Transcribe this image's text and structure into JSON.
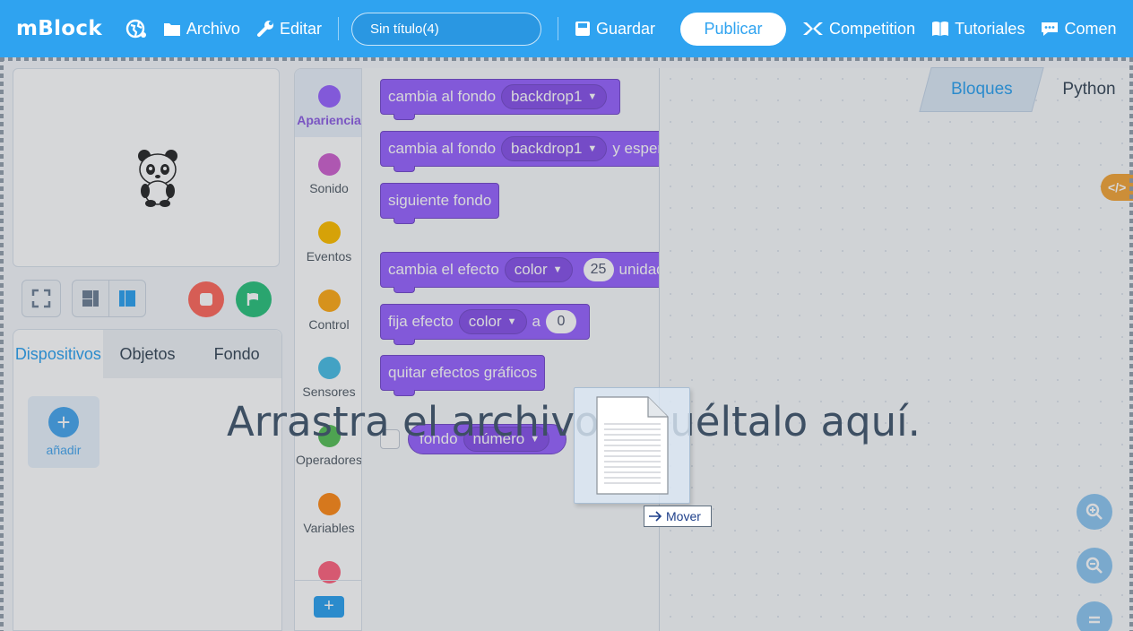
{
  "app": {
    "logo": "mBlock",
    "menu": {
      "file_label": "Archivo",
      "edit_label": "Editar",
      "save_label": "Guardar",
      "publish_label": "Publicar",
      "competition_label": "Competition",
      "tutorials_label": "Tutoriales",
      "comments_label": "Comen"
    },
    "project_title": "Sin título(4)",
    "accent_color": "#2fa3f0"
  },
  "left_panel": {
    "tabs": [
      "Dispositivos",
      "Objetos",
      "Fondo"
    ],
    "active_tab": "Dispositivos",
    "add_label": "añadir"
  },
  "categories": [
    {
      "label": "Apariencia",
      "color": "#9966ff",
      "active": true
    },
    {
      "label": "Sonido",
      "color": "#cf63cf"
    },
    {
      "label": "Eventos",
      "color": "#ffbf00"
    },
    {
      "label": "Control",
      "color": "#ffab19"
    },
    {
      "label": "Sensores",
      "color": "#4cbfe6"
    },
    {
      "label": "Operadores",
      "color": "#59c059"
    },
    {
      "label": "Variables",
      "color": "#ff8c1a"
    },
    {
      "label": "",
      "color": "#ff6680"
    }
  ],
  "blocks": {
    "b1": {
      "text": "cambia al fondo",
      "dropdown": "backdrop1"
    },
    "b2": {
      "text": "cambia al fondo",
      "dropdown": "backdrop1",
      "suffix": "y esper"
    },
    "b3": {
      "text": "siguiente fondo"
    },
    "b4": {
      "text": "cambia el efecto",
      "dropdown": "color",
      "value": "25",
      "suffix": "unidad"
    },
    "b5": {
      "text": "fija efecto",
      "dropdown": "color",
      "mid": "a",
      "value": "0"
    },
    "b6": {
      "text": "quitar efectos gráficos"
    },
    "b7": {
      "text": "fondo",
      "dropdown": "número"
    }
  },
  "workspace": {
    "tabs": [
      "Bloques",
      "Python"
    ],
    "active_tab": "Bloques",
    "code_badge": "</>"
  },
  "drag_overlay": {
    "message": "Arrastra el archivo y suéltalo aquí.",
    "tooltip": "Mover"
  }
}
